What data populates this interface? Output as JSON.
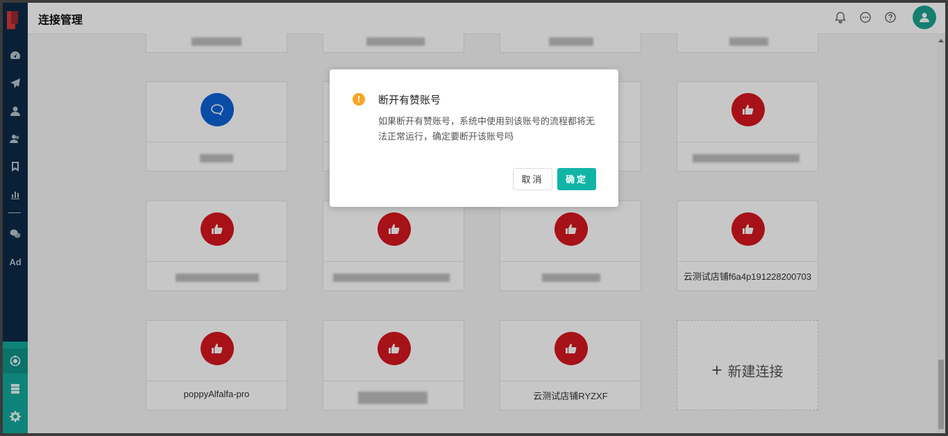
{
  "header": {
    "title": "连接管理",
    "icons": [
      "bell-icon",
      "chat-icon",
      "help-icon"
    ],
    "avatar": "user-avatar"
  },
  "sidebar": {
    "icons": [
      "dashboard-icon",
      "send-icon",
      "user-icon",
      "users-icon",
      "bookmark-icon",
      "chart-icon",
      "wechat-icon"
    ],
    "ad_label": "Ad",
    "bottom_icons": [
      "connections-icon",
      "server-icon",
      "gear-icon"
    ]
  },
  "cards": {
    "row3_col4_name": "云测试店铺f6a4p191228200703",
    "row4_col1_name": "poppyAlfalfa-pro",
    "row4_col3_name": "云测试店铺RYZXF",
    "new_connection_label": "新建连接",
    "new_connection_icon": "+"
  },
  "dialog": {
    "title": "断开有赞账号",
    "message": "如果断开有赞账号，系统中使用到该账号的流程都将无法正常运行，确定要断开该账号吗",
    "cancel_label": "取消",
    "confirm_label": "确定",
    "warning_icon": "!"
  },
  "colors": {
    "accent": "#12b5a5",
    "sidebar": "#0e2a47",
    "youzan_red": "#d7171f",
    "chat_blue": "#0b62d6",
    "warning": "#f5a623"
  }
}
